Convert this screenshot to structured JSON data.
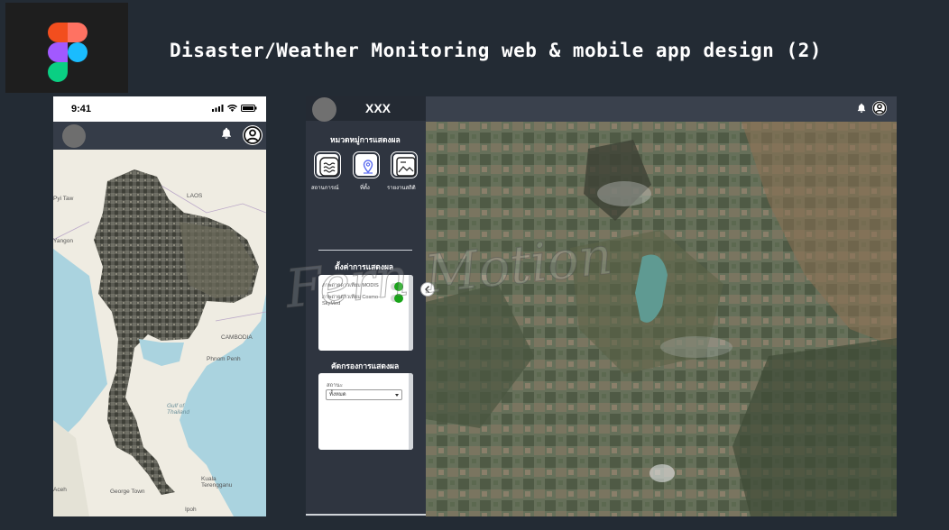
{
  "header": {
    "title": "Disaster/Weather Monitoring web & mobile app design (2)"
  },
  "mobile": {
    "status_time": "9:41",
    "map_labels": {
      "laos": "LAOS",
      "cambodia": "CAMBODIA",
      "phnom_penh": "Phnom Penh",
      "gulf": "Gulf of\nThailand",
      "pyin": "Pyi Taw",
      "yangon": "Yangon",
      "kuala": "Kuala\nTerengganu",
      "ipoh": "Ipoh",
      "george": "George Town",
      "aceh": "Aceh"
    }
  },
  "web": {
    "brand": "XXX",
    "categories_title": "หมวดหมู่การแสดงผล",
    "categories": [
      {
        "label": "สถานการณ์",
        "icon": "waves-icon"
      },
      {
        "label": "ที่ตั้ง",
        "icon": "location-pin-icon"
      },
      {
        "label": "รายงานสถิติ",
        "icon": "image-report-icon"
      }
    ],
    "settings_title": "ตั้งค่าการแสดงผล",
    "layers": [
      {
        "label": "ภาพถ่ายดาวเทียม MODIS",
        "enabled": true
      },
      {
        "label": "ภาพถ่ายดาวเทียม Cosmo-SkyMed",
        "enabled": true
      }
    ],
    "filter_title": "คัดกรองการแสดงผล",
    "filter_field_label": "สถานะ",
    "filter_field_value": "ทั้งหมด"
  },
  "colors": {
    "background": "#232b34",
    "sidebar": "#2f3540",
    "toggle_on": "#1aa51a"
  }
}
